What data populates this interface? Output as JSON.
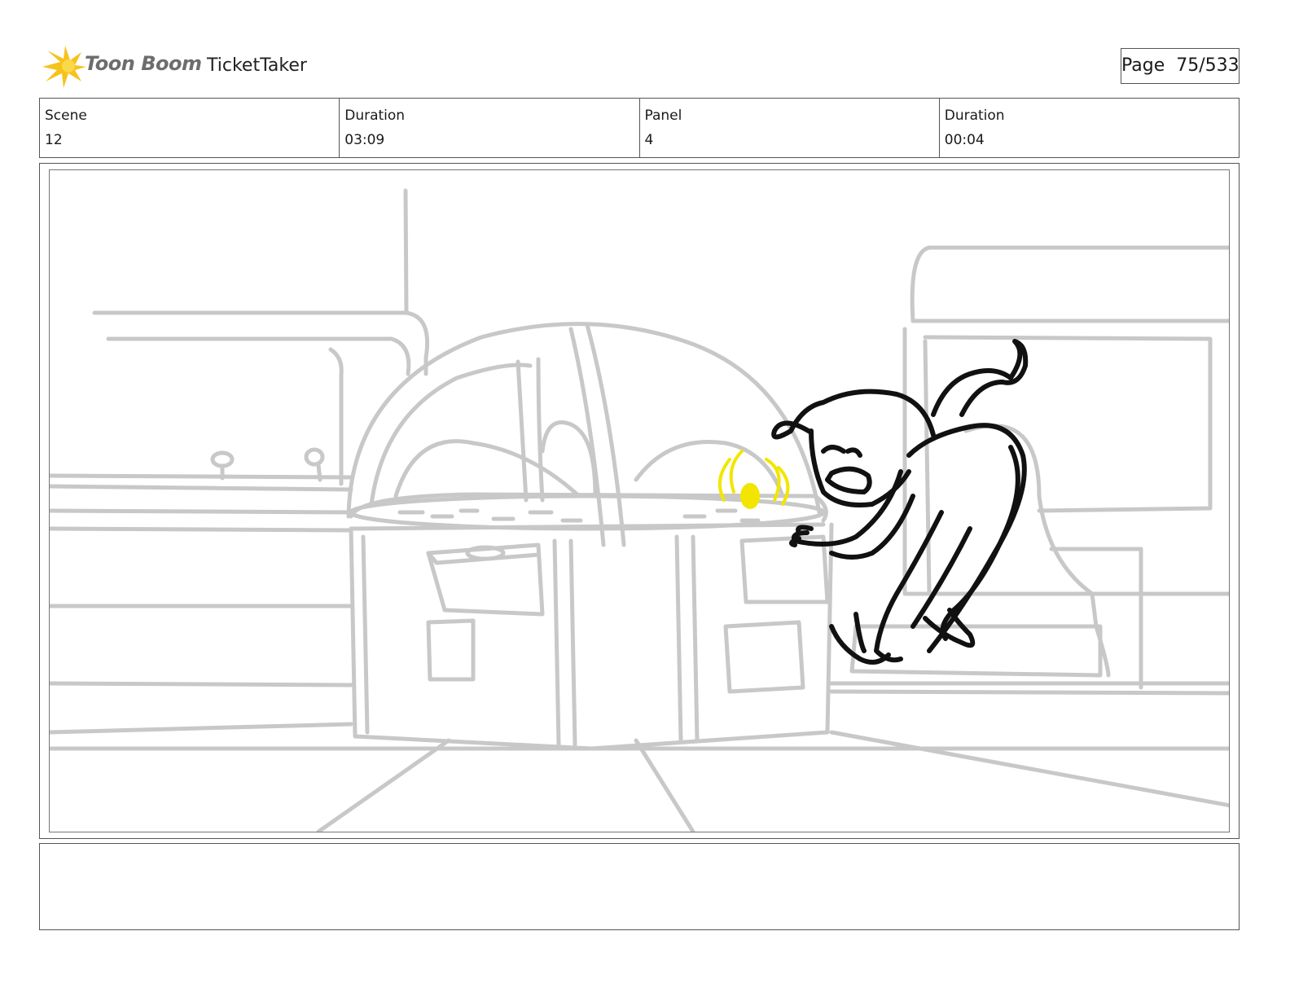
{
  "header": {
    "logo_text": "Toon Boom",
    "project_title": "TicketTaker",
    "page_label": "Page",
    "page_value": "75/533"
  },
  "info": {
    "scene_label": "Scene",
    "scene_value": "12",
    "scene_duration_label": "Duration",
    "scene_duration_value": "03:09",
    "panel_label": "Panel",
    "panel_value": "4",
    "panel_duration_label": "Duration",
    "panel_duration_value": "00:04"
  },
  "panel_image": {
    "line_colors": {
      "background": "#c8c8c8",
      "character": "#111111",
      "highlight": "#f2e600"
    }
  },
  "notes": {
    "text": ""
  }
}
